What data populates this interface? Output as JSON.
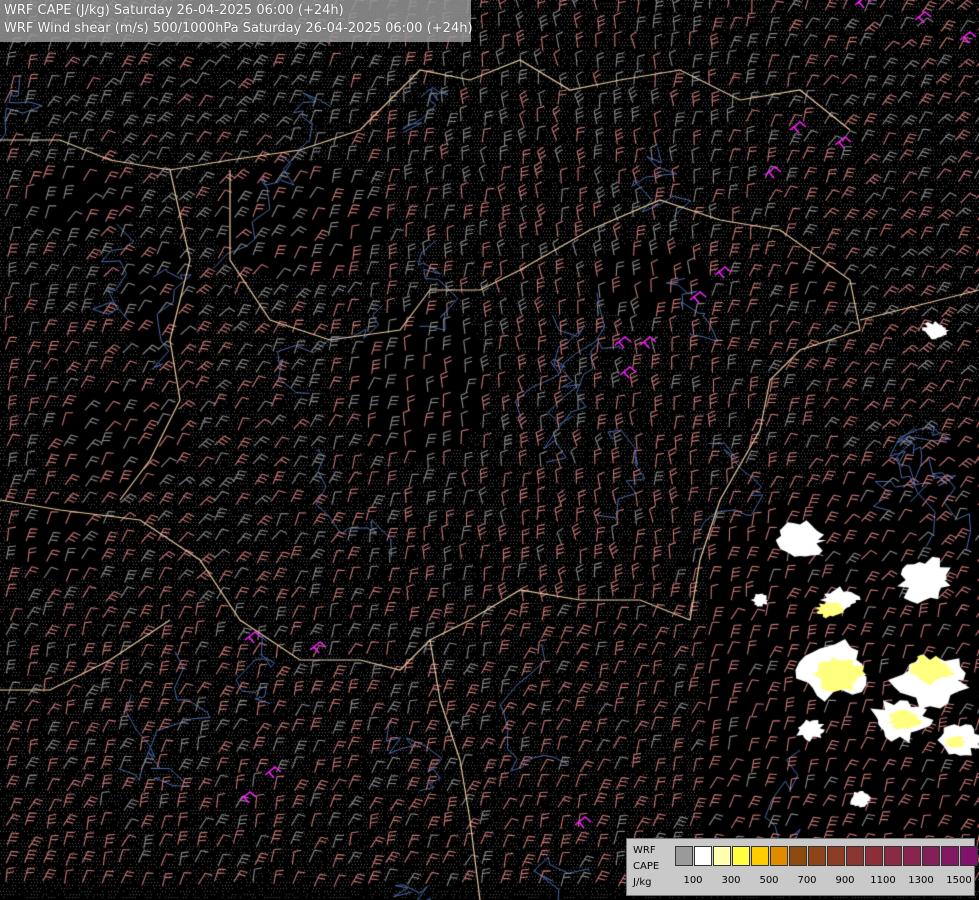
{
  "title": {
    "line1": "WRF CAPE (J/kg) Saturday 26-04-2025 06:00 (+24h)",
    "line2": "WRF Wind shear (m/s) 500/1000hPa Saturday 26-04-2025 06:00 (+24h)"
  },
  "legend": {
    "label_line1": "WRF",
    "label_line2": "CAPE",
    "label_line3": "J/kg",
    "colors": [
      "#9a9a9a",
      "#ffffff",
      "#ffffb0",
      "#ffff40",
      "#ffcc00",
      "#e08a00",
      "#8a4a10",
      "#8c4418",
      "#8c3e24",
      "#8a3630",
      "#8c2e3a",
      "#8a2a44",
      "#88244e",
      "#842058",
      "#821a62",
      "#80126c",
      "#800c76",
      "#7e0880",
      "#7c0088",
      "#7a0092"
    ],
    "ticks": [
      "100",
      "300",
      "500",
      "700",
      "900",
      "1100",
      "1300",
      "1500"
    ]
  },
  "map": {
    "background": "#000000",
    "border_color": "#e8c9a0",
    "river_color": "#4a6aa8",
    "cape_low_color": "#ffffff",
    "cape_mid_color": "#ffff80",
    "shear_high_color": "#ff20ff",
    "barb_color_low": "#8a8a8a",
    "barb_color_high": "#c87878"
  }
}
